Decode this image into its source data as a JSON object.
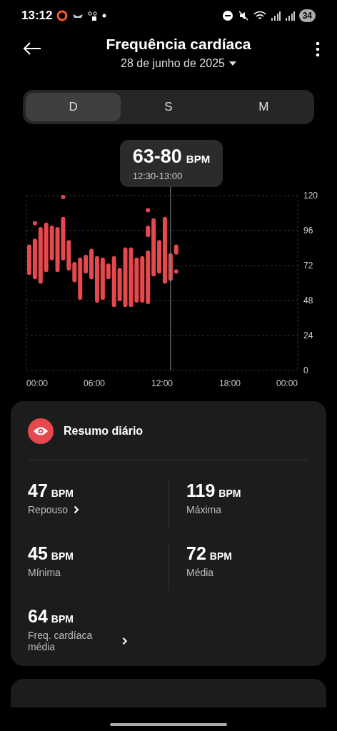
{
  "status_bar": {
    "time": "13:12",
    "battery": "34"
  },
  "header": {
    "title": "Frequência cardíaca",
    "date": "28 de junho de 2025"
  },
  "tabs": [
    {
      "label": "D",
      "selected": true
    },
    {
      "label": "S",
      "selected": false
    },
    {
      "label": "M",
      "selected": false
    }
  ],
  "tooltip": {
    "value": "63-80",
    "unit": "BPM",
    "range": "12:30-13:00"
  },
  "chart": {
    "y_labels": [
      "120",
      "96",
      "72",
      "48",
      "24",
      "0"
    ],
    "x_labels": [
      "00:00",
      "06:00",
      "12:00",
      "18:00",
      "00:00"
    ]
  },
  "summary": {
    "title": "Resumo diário",
    "stats": [
      {
        "value": "47",
        "unit": "BPM",
        "label": "Repouso",
        "link": true
      },
      {
        "value": "119",
        "unit": "BPM",
        "label": "Máxima",
        "link": false
      },
      {
        "value": "45",
        "unit": "BPM",
        "label": "Mínima",
        "link": false
      },
      {
        "value": "72",
        "unit": "BPM",
        "label": "Média",
        "link": false
      },
      {
        "value": "64",
        "unit": "BPM",
        "label": "Freq. cardíaca média",
        "link": true
      }
    ]
  }
}
